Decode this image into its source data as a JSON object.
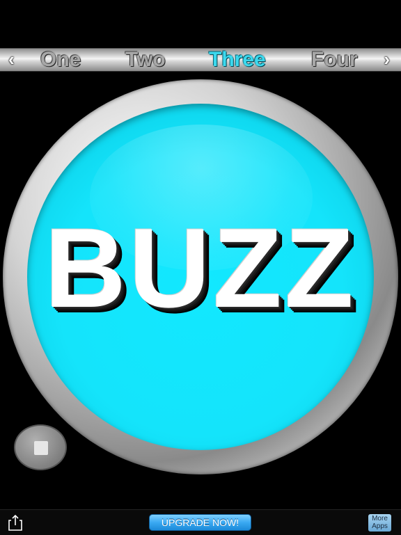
{
  "tabs": {
    "prev_arrow": "‹",
    "next_arrow": "›",
    "items": [
      {
        "label": "One",
        "active": false
      },
      {
        "label": "Two",
        "active": false
      },
      {
        "label": "Three",
        "active": true
      },
      {
        "label": "Four",
        "active": false
      }
    ]
  },
  "buzzer": {
    "label": "BUZZ",
    "face_color": "#14e4fb"
  },
  "controls": {
    "stop_icon": "stop-icon"
  },
  "bottom_bar": {
    "share_icon": "share-icon",
    "upgrade_label": "UPGRADE NOW!",
    "more_apps_line1": "More",
    "more_apps_line2": "Apps"
  }
}
